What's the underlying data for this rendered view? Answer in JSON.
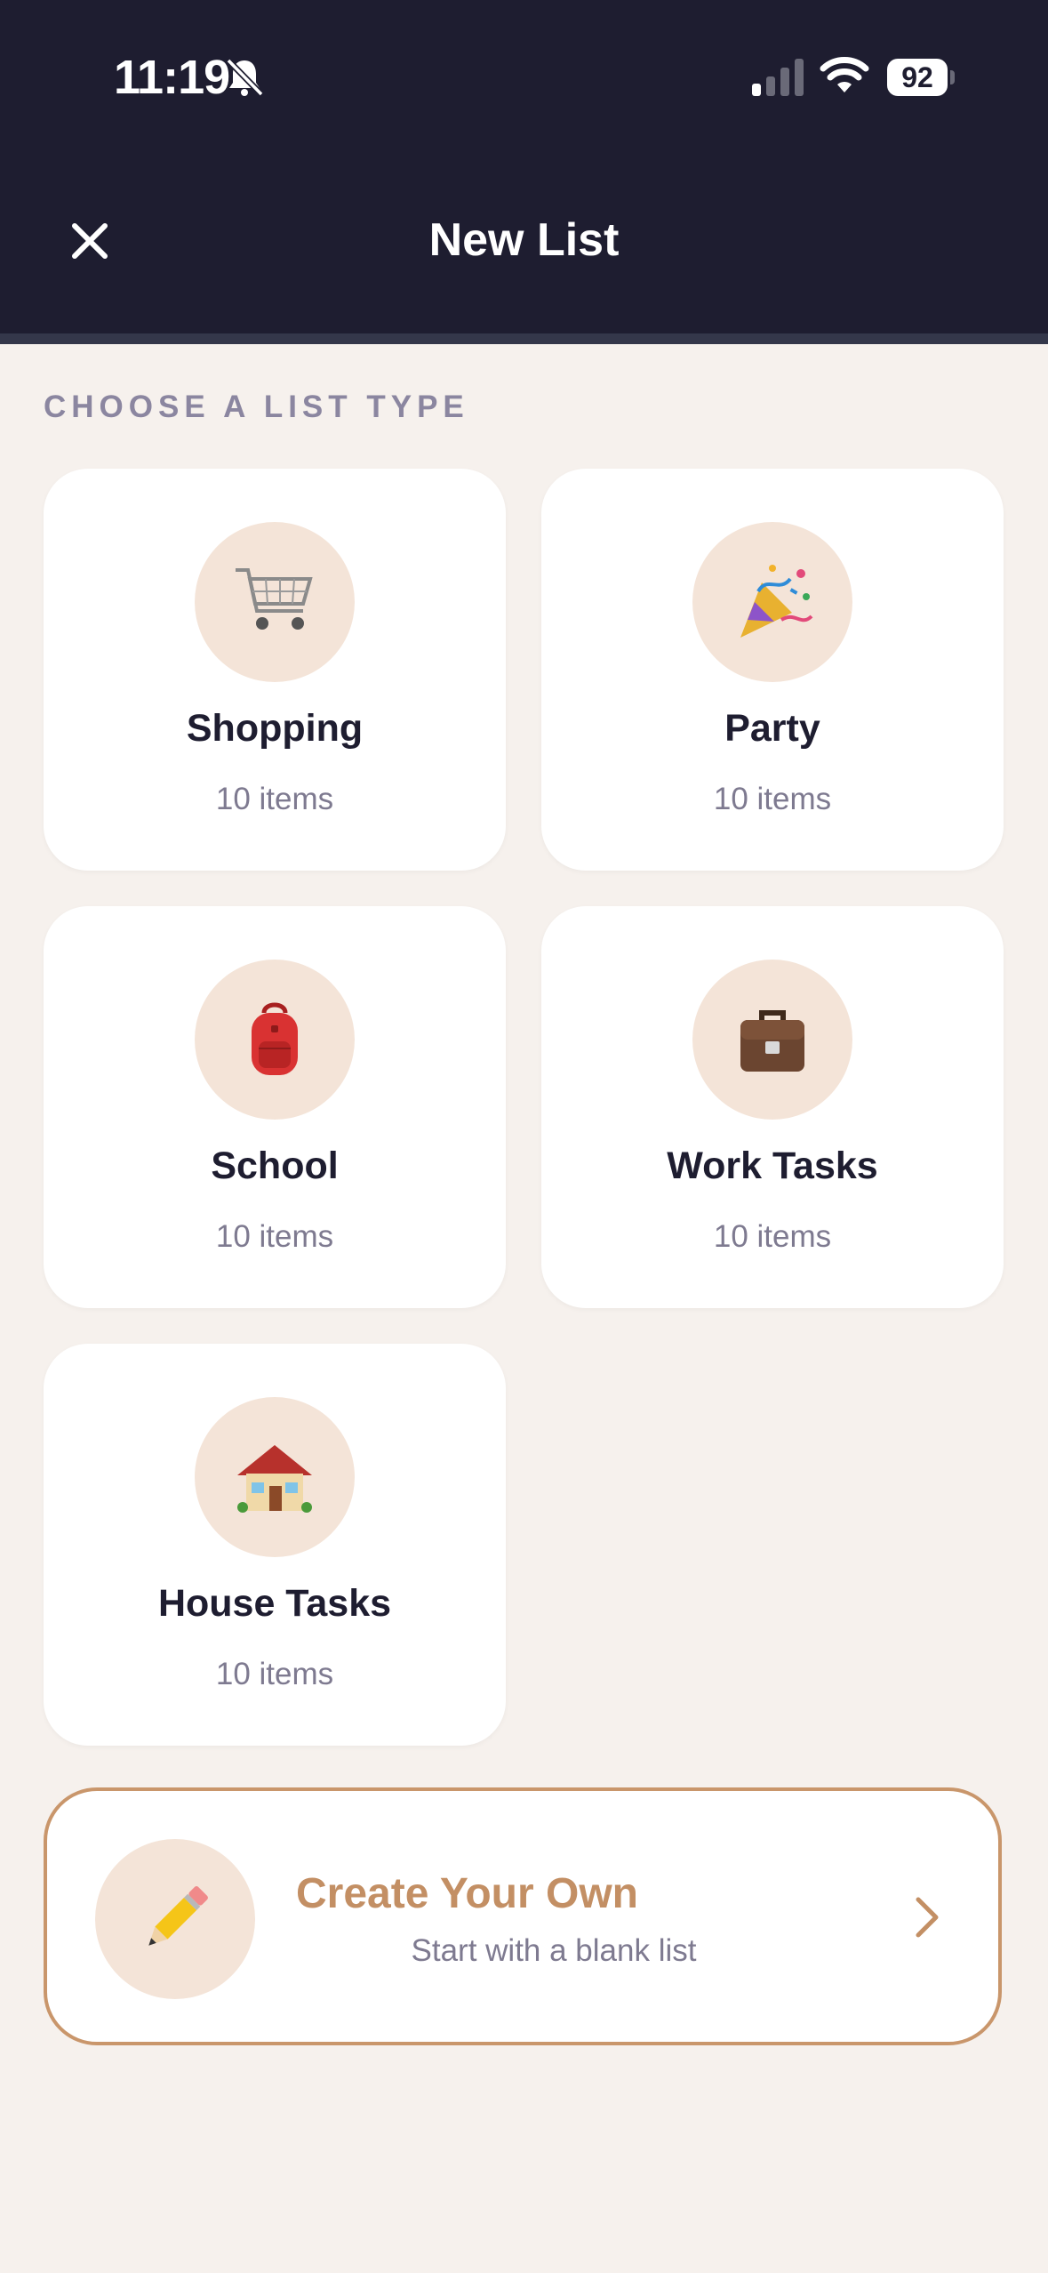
{
  "status_bar": {
    "time": "11:19",
    "battery": "92"
  },
  "header": {
    "title": "New List"
  },
  "section": {
    "label": "CHOOSE A LIST TYPE"
  },
  "list_types": [
    {
      "name": "Shopping",
      "count": "10 items",
      "icon": "shopping-cart-icon"
    },
    {
      "name": "Party",
      "count": "10 items",
      "icon": "party-popper-icon"
    },
    {
      "name": "School",
      "count": "10 items",
      "icon": "backpack-icon"
    },
    {
      "name": "Work Tasks",
      "count": "10 items",
      "icon": "briefcase-icon"
    },
    {
      "name": "House Tasks",
      "count": "10 items",
      "icon": "house-icon"
    }
  ],
  "create_own": {
    "title": "Create Your Own",
    "subtitle": "Start with a blank list",
    "icon": "pencil-icon"
  },
  "colors": {
    "header_bg": "#1e1d30",
    "page_bg": "#f6f1ed",
    "accent": "#c38f64",
    "icon_circle_bg": "#f4e4d8"
  }
}
